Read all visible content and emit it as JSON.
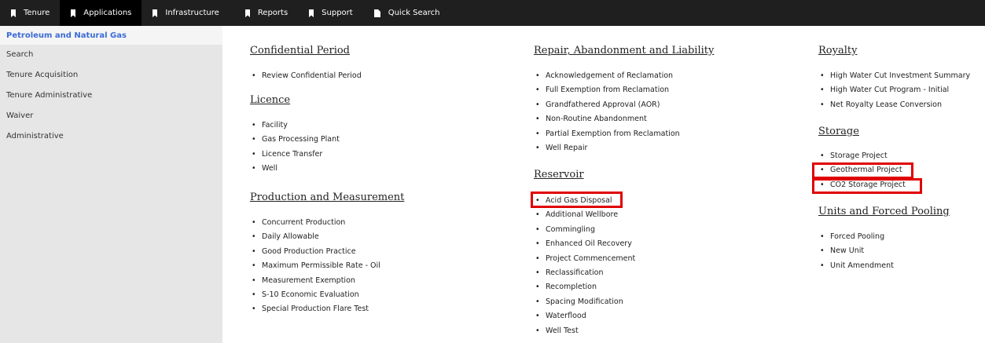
{
  "nav": {
    "items": [
      {
        "label": "Tenure",
        "active": false
      },
      {
        "label": "Applications",
        "active": true
      },
      {
        "label": "Infrastructure",
        "active": false
      },
      {
        "label": "Reports",
        "active": false
      },
      {
        "label": "Support",
        "active": false
      },
      {
        "label": "Quick Search",
        "active": false,
        "icon": "document-icon"
      }
    ]
  },
  "sidebar": {
    "heading": "Petroleum and Natural Gas",
    "items": [
      {
        "label": "Search"
      },
      {
        "label": "Tenure Acquisition"
      },
      {
        "label": "Tenure Administrative"
      },
      {
        "label": "Waiver"
      },
      {
        "label": "Administrative"
      }
    ]
  },
  "columns": {
    "col1": {
      "confidential": {
        "title": "Confidential Period",
        "items": [
          "Review Confidential Period"
        ]
      },
      "licence": {
        "title": "Licence",
        "items": [
          "Facility",
          "Gas Processing Plant",
          "Licence Transfer",
          "Well"
        ]
      },
      "production": {
        "title": "Production and Measurement",
        "items": [
          "Concurrent Production",
          "Daily Allowable",
          "Good Production Practice",
          "Maximum Permissible Rate - Oil",
          "Measurement Exemption",
          "S-10 Economic Evaluation",
          "Special Production Flare Test"
        ]
      }
    },
    "col2": {
      "repair": {
        "title": "Repair, Abandonment and Liability",
        "items": [
          "Acknowledgement of Reclamation",
          "Full Exemption from Reclamation",
          "Grandfathered Approval (AOR)",
          "Non-Routine Abandonment",
          "Partial Exemption from Reclamation",
          "Well Repair"
        ]
      },
      "reservoir": {
        "title": "Reservoir",
        "items": [
          "Acid Gas Disposal",
          "Additional Wellbore",
          "Commingling",
          "Enhanced Oil Recovery",
          "Project Commencement",
          "Reclassification",
          "Recompletion",
          "Spacing Modification",
          "Waterflood",
          "Well Test"
        ]
      }
    },
    "col3": {
      "royalty": {
        "title": "Royalty",
        "items": [
          "High Water Cut Investment Summary",
          "High Water Cut Program - Initial",
          "Net Royalty Lease Conversion"
        ]
      },
      "storage": {
        "title": "Storage",
        "items": [
          "Storage Project",
          "Geothermal Project",
          "CO2 Storage Project"
        ]
      },
      "units": {
        "title": "Units and Forced Pooling",
        "items": [
          "Forced Pooling",
          "New Unit",
          "Unit Amendment"
        ]
      }
    }
  },
  "colors": {
    "nav_bg": "#1f1f1f",
    "nav_active_bg": "#000000",
    "sidebar_bg": "#e6e6e6",
    "sidebar_heading": "#3b6bd6",
    "highlight": "#e00000"
  }
}
